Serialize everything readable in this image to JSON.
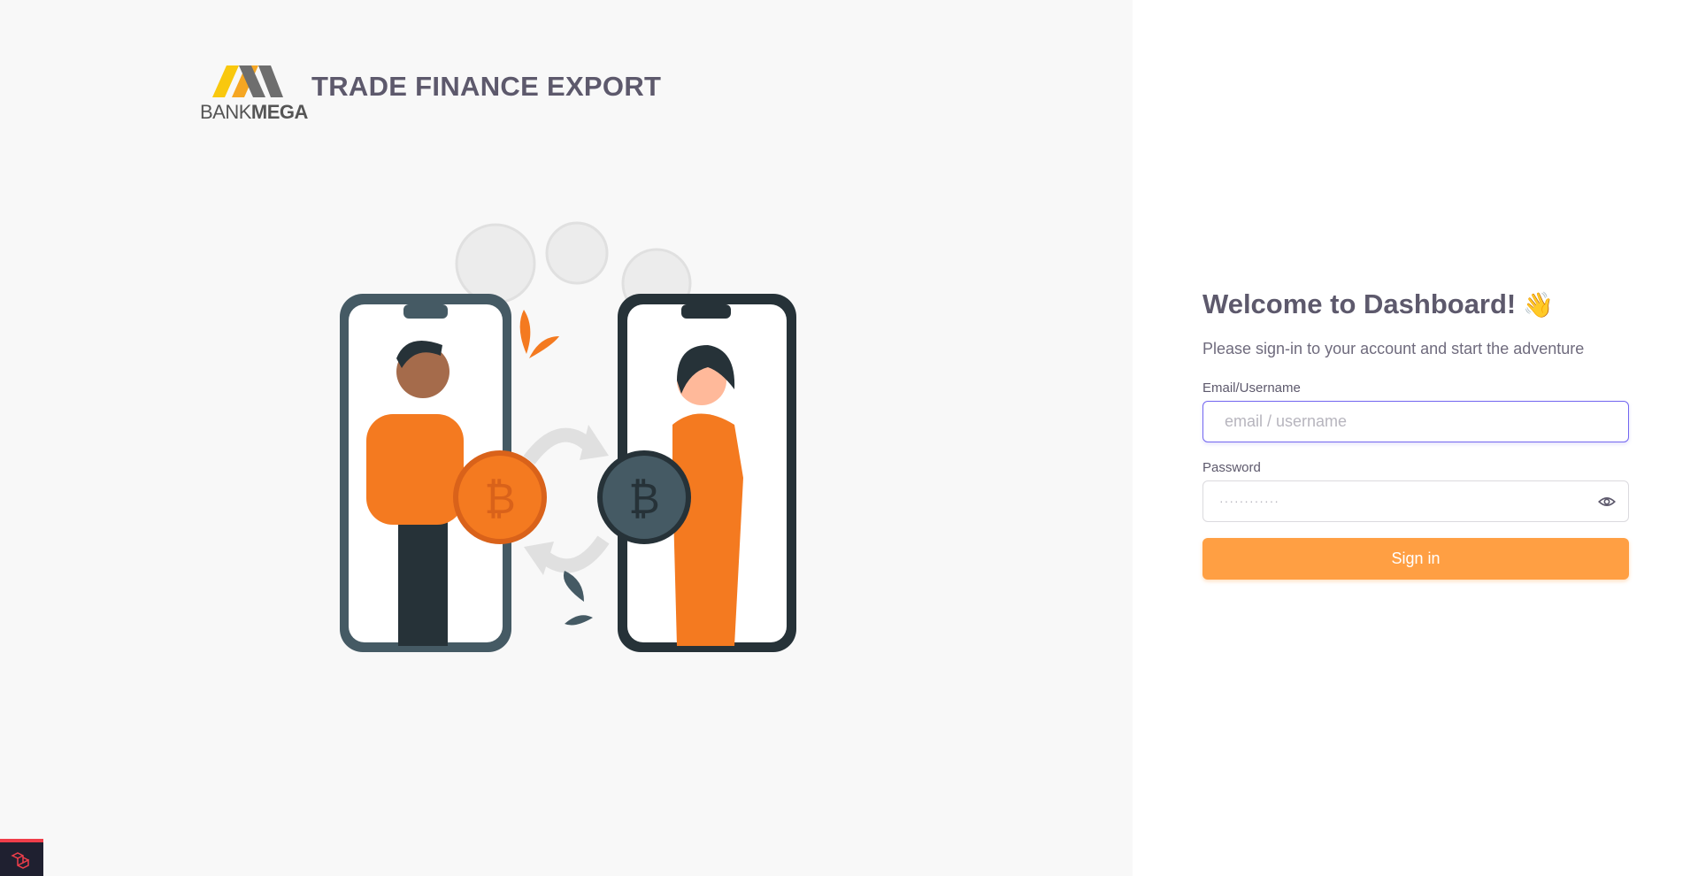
{
  "brand": {
    "logo_text_light": "BANK",
    "logo_text_bold": "MEGA",
    "app_title": "TRADE FINANCE EXPORT"
  },
  "login": {
    "welcome": "Welcome to Dashboard!",
    "wave_emoji": "👋",
    "subtitle": "Please sign-in to your account and start the adventure",
    "email_label": "Email/Username",
    "email_placeholder": "email / username",
    "password_label": "Password",
    "password_placeholder": "············",
    "signin_label": "Sign in"
  },
  "icons": {
    "password_toggle": "eye-icon",
    "debug_badge": "laravel-icon"
  },
  "colors": {
    "accent": "#7367f0",
    "signin": "#ff9f43",
    "title": "#5d596c",
    "illustration_orange": "#f47a20",
    "illustration_dark": "#263238"
  }
}
